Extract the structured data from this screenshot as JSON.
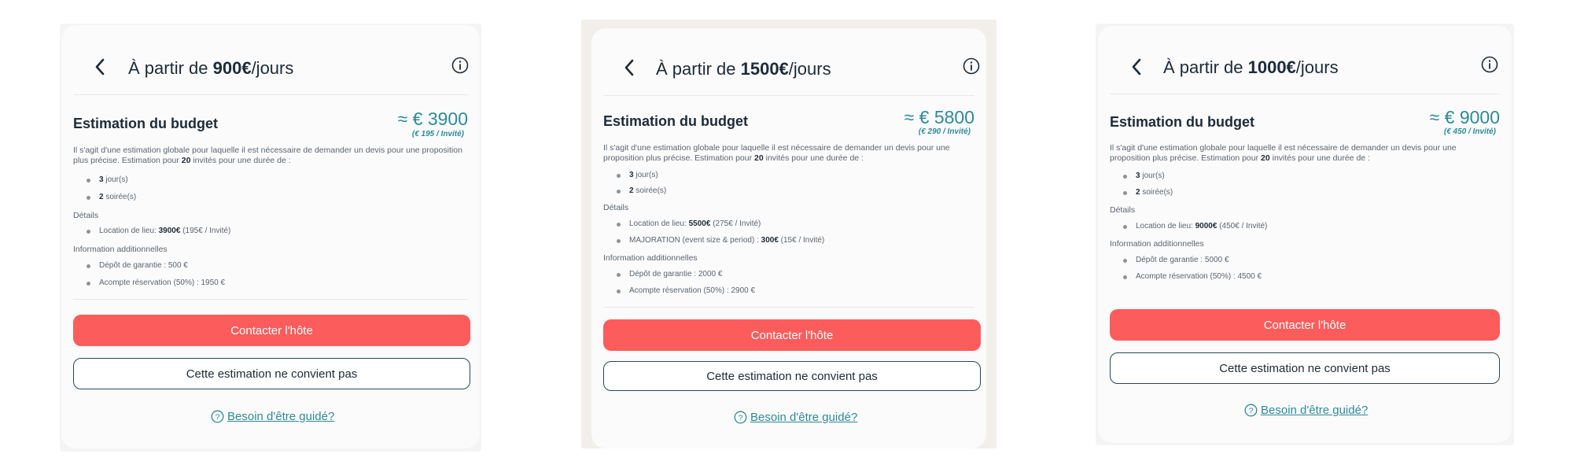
{
  "cards": [
    {
      "title_prefix": "À partir de ",
      "title_price": "900€",
      "title_suffix": "/jours",
      "estimation_title": "Estimation du budget",
      "total": "≈ € 3900",
      "per_guest": "(€ 195 / Invité)",
      "desc_1": "Il s'agit d'une estimation globale pour laquelle il est nécessaire de demander un devis pour une proposition plus précise. Estimation pour ",
      "guests": "20",
      "desc_2": " invités pour une durée de :",
      "duration": [
        {
          "bold": "3",
          "text": " jour(s)"
        },
        {
          "bold": "2",
          "text": " soirée(s)"
        }
      ],
      "details_label": "Détails",
      "details": [
        {
          "label": "Location de lieu: ",
          "bold": "3900€",
          "text": " (195€ / Invité)"
        }
      ],
      "info_label": "Information additionnelles",
      "info": [
        {
          "text": "Dépôt de garantie : 500 €"
        },
        {
          "text": "Acompte réservation (50%) : 1950 €"
        }
      ],
      "contact_label": "Contacter l'hôte",
      "reject_label": "Cette estimation ne convient pas",
      "help_label": "Besoin d'être guidé?"
    },
    {
      "title_prefix": "À partir de ",
      "title_price": "1500€",
      "title_suffix": "/jours",
      "estimation_title": "Estimation du budget",
      "total": "≈ € 5800",
      "per_guest": "(€ 290 / Invité)",
      "desc_1": "Il s'agit d'une estimation globale pour laquelle il est nécessaire de demander un devis pour une proposition plus précise. Estimation pour ",
      "guests": "20",
      "desc_2": " invités pour une durée de :",
      "duration": [
        {
          "bold": "3",
          "text": " jour(s)"
        },
        {
          "bold": "2",
          "text": " soirée(s)"
        }
      ],
      "details_label": "Détails",
      "details": [
        {
          "label": "Location de lieu: ",
          "bold": "5500€",
          "text": " (275€ / Invité)"
        },
        {
          "label": "MAJORATION (event size & period) : ",
          "bold": "300€",
          "text": " (15€ / Invité)"
        }
      ],
      "info_label": "Information additionnelles",
      "info": [
        {
          "text": "Dépôt de garantie : 2000 €"
        },
        {
          "text": "Acompte réservation (50%) : 2900 €"
        }
      ],
      "contact_label": "Contacter l'hôte",
      "reject_label": "Cette estimation ne convient pas",
      "help_label": "Besoin d'être guidé?"
    },
    {
      "title_prefix": "À partir de ",
      "title_price": "1000€",
      "title_suffix": "/jours",
      "estimation_title": "Estimation du budget",
      "total": "≈ € 9000",
      "per_guest": "(€ 450 / Invité)",
      "desc_1": "Il s'agit d'une estimation globale pour laquelle il est nécessaire de demander un devis pour une proposition plus précise. Estimation pour ",
      "guests": "20",
      "desc_2": " invités pour une durée de :",
      "duration": [
        {
          "bold": "3",
          "text": " jour(s)"
        },
        {
          "bold": "2",
          "text": " soirée(s)"
        }
      ],
      "details_label": "Détails",
      "details": [
        {
          "label": "Location de lieu: ",
          "bold": "9000€",
          "text": " (450€ / Invité)"
        }
      ],
      "info_label": "Information additionnelles",
      "info": [
        {
          "text": "Dépôt de garantie : 5000 €"
        },
        {
          "text": "Acompte réservation (50%) : 4500 €"
        }
      ],
      "contact_label": "Contacter l'hôte",
      "reject_label": "Cette estimation ne convient pas",
      "help_label": "Besoin d'être guidé?"
    }
  ],
  "colors": {
    "accent": "#fd5c5c",
    "teal": "#2e8a97",
    "text_dark": "#1d2b3a",
    "border_dark": "#2c4656"
  },
  "icons": [
    "chevron-left-icon",
    "info-circle-icon",
    "question-circle-icon"
  ]
}
